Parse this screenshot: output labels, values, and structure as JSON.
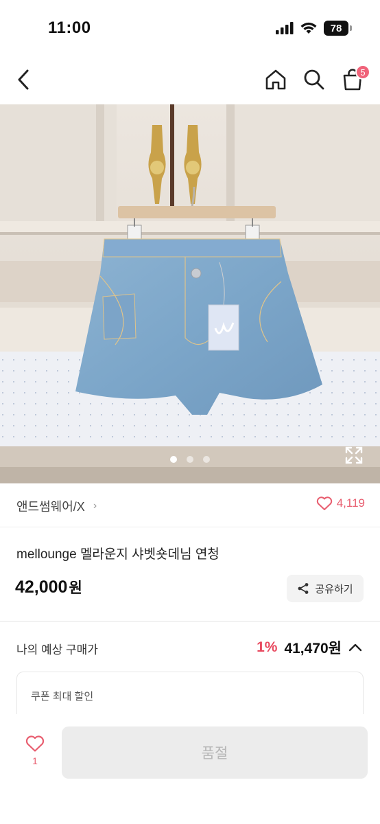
{
  "status_bar": {
    "time": "11:00",
    "battery": "78",
    "icons": [
      "signal-icon",
      "wifi-icon",
      "battery-icon"
    ]
  },
  "nav": {
    "back_icon": "chevron-left-icon",
    "home_icon": "home-icon",
    "search_icon": "search-icon",
    "cart_icon": "shopping-bag-icon",
    "cart_badge": "5"
  },
  "gallery": {
    "image_subject": "light wash denim shorts hanging on a wooden hanger",
    "page_count": 3,
    "current_page": 1,
    "expand_icon": "expand-icon"
  },
  "shop": {
    "name": "앤드썸웨어/X",
    "chevron": "›",
    "like_icon": "heart-outline-icon",
    "like_count": "4,119"
  },
  "product": {
    "title": "mellounge 멜라운지 샤벳숏데님 연청",
    "price": "42,000",
    "currency": "원",
    "share_label": "공유하기",
    "share_icon": "share-icon"
  },
  "estimate": {
    "label": "나의 예상 구매가",
    "discount_percent": "1%",
    "price": "41,470원",
    "toggle_icon": "chevron-up-icon"
  },
  "coupon": {
    "label": "쿠폰 최대 할인"
  },
  "bottom_bar": {
    "fav_icon": "heart-outline-icon",
    "fav_count": "1",
    "soldout_label": "품절"
  },
  "colors": {
    "accent_pink": "#e85d6f",
    "discount_red": "#e8495f",
    "disabled_bg": "#ececec",
    "disabled_text": "#b7b7b7"
  }
}
